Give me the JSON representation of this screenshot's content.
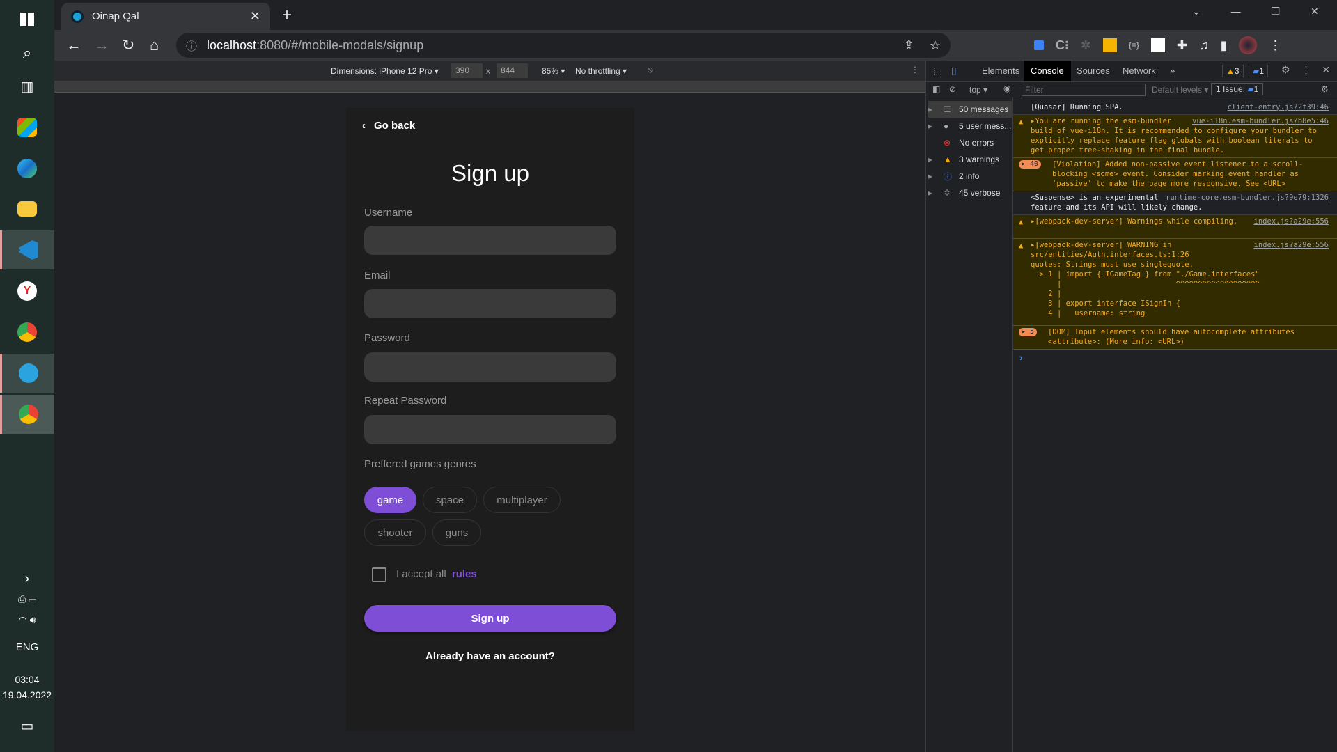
{
  "taskbar": {
    "tray": {
      "lang": "ENG",
      "time": "03:04",
      "date": "19.04.2022"
    }
  },
  "browser": {
    "tab_title": "Oinap Qal",
    "url_host": "localhost",
    "url_rest": ":8080/#/mobile-modals/signup"
  },
  "device_toolbar": {
    "dimensions": "Dimensions: iPhone 12 Pro ▾",
    "width": "390",
    "height": "844",
    "zoom": "85% ▾",
    "throttling": "No throttling ▾",
    "x": "x"
  },
  "app": {
    "go_back": "Go back",
    "title": "Sign up",
    "fields": [
      {
        "label": "Username",
        "value": ""
      },
      {
        "label": "Email",
        "value": ""
      },
      {
        "label": "Password",
        "value": ""
      },
      {
        "label": "Repeat Password",
        "value": ""
      }
    ],
    "genres_label": "Preffered games genres",
    "genres": [
      {
        "label": "game",
        "selected": true
      },
      {
        "label": "space",
        "selected": false
      },
      {
        "label": "multiplayer",
        "selected": false
      },
      {
        "label": "shooter",
        "selected": false
      },
      {
        "label": "guns",
        "selected": false
      }
    ],
    "accept_text": "I accept all",
    "rules_link": "rules",
    "submit": "Sign up",
    "have_account": "Already have an account?",
    "accent": "#7e4fd6"
  },
  "devtools": {
    "tabs": [
      "Elements",
      "Console",
      "Sources",
      "Network",
      "»"
    ],
    "warn_count": "3",
    "msg_count": "1",
    "context": "top ▾",
    "filter_placeholder": "Filter",
    "levels": "Default levels ▾",
    "issues": "1 Issue:",
    "issues_count": "1",
    "sidebar": [
      "50 messages",
      "5 user mess...",
      "No errors",
      "3 warnings",
      "2 info",
      "45 verbose"
    ],
    "messages": [
      {
        "type": "info",
        "text": "[Quasar] Running SPA.",
        "src": "client-entry.js?2f39:46"
      },
      {
        "type": "warn",
        "text": "▸You are running the esm-bundler build of vue-i18n. It is recommended to configure your bundler to explicitly replace feature flag globals with boolean literals to get proper tree-shaking in the final bundle.",
        "src": "vue-i18n.esm-bundler.js?b8e5:46"
      },
      {
        "type": "violation",
        "count": "▸ 40",
        "text": "[Violation] Added non-passive event listener to a scroll-blocking <some> event. Consider marking event handler as 'passive' to make the page more responsive. See <URL>",
        "src": ""
      },
      {
        "type": "info",
        "text": "<Suspense> is an experimental feature and its API will likely change.",
        "src": "runtime-core.esm-bundler.js?9e79:1326"
      },
      {
        "type": "warn",
        "text": "▸[webpack-dev-server] Warnings while compiling.",
        "src": "index.js?a29e:556"
      },
      {
        "type": "warn",
        "text": "▸[webpack-dev-server] WARNING in src/entities/Auth.interfaces.ts:1:26\nquotes: Strings must use singlequote.\n  > 1 | import { IGameTag } from \"./Game.interfaces\"\n      |                          ^^^^^^^^^^^^^^^^^^^\n    2 |\n    3 | export interface ISignIn {\n    4 |   username: string",
        "src": "index.js?a29e:556"
      },
      {
        "type": "violation",
        "count": "▸ 5",
        "text": "[DOM] Input elements should have autocomplete attributes <attribute>: (More info: <URL>)",
        "src": ""
      }
    ],
    "prompt": "›"
  }
}
